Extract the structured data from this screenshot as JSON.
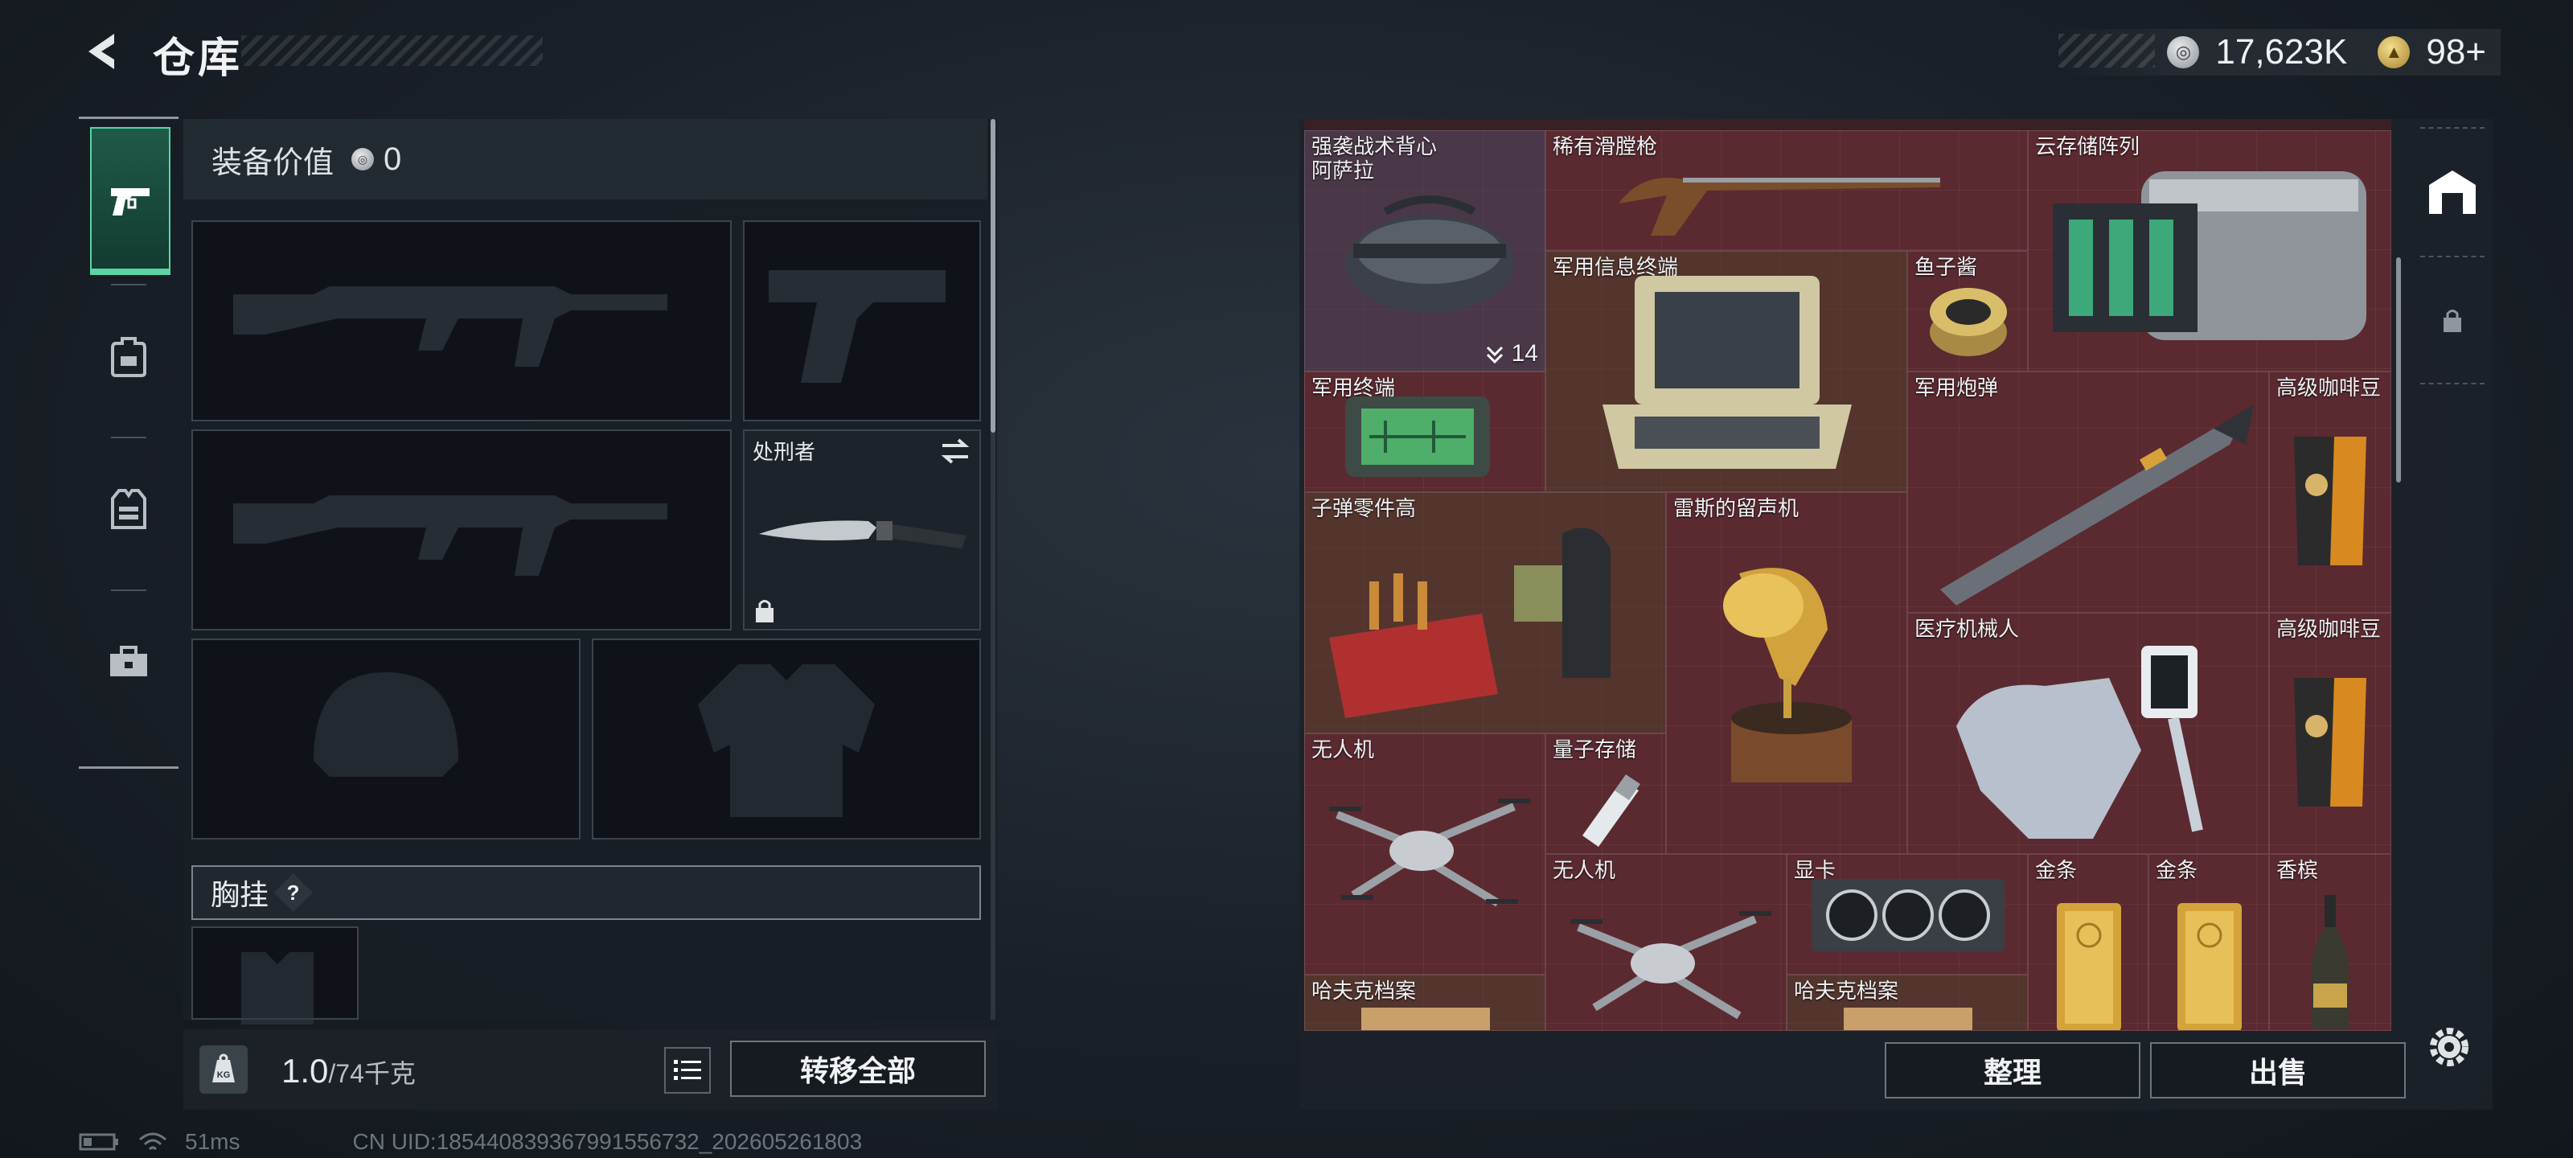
{
  "header": {
    "title": "仓库"
  },
  "currency": {
    "silver": "17,623K",
    "gold": "98+"
  },
  "left_tabs": [
    {
      "name": "weapons",
      "active": true
    },
    {
      "name": "backpack",
      "active": false
    },
    {
      "name": "vest",
      "active": false
    },
    {
      "name": "toolbox",
      "active": false
    }
  ],
  "equipment": {
    "value_label": "装备价值",
    "value": "0",
    "melee_name": "处刑者",
    "chest_label": "胸挂",
    "chest_help": "?"
  },
  "weight": {
    "current": "1.0",
    "max": "/74千克",
    "icon_text": "KG"
  },
  "buttons": {
    "transfer_all": "转移全部",
    "sort": "整理",
    "sell": "出售"
  },
  "status": {
    "ping": "51ms",
    "uid": "CN UID:1854408393679915567​32_202605261803"
  },
  "storage_items": [
    {
      "label": "强袭战术背心\n阿萨拉",
      "count": "14"
    },
    {
      "label": "稀有滑膛枪"
    },
    {
      "label": "云存储阵列"
    },
    {
      "label": "军用信息终端"
    },
    {
      "label": "鱼子酱"
    },
    {
      "label": "军用终端"
    },
    {
      "label": "军用炮弹"
    },
    {
      "label": "高级咖啡豆"
    },
    {
      "label": "子弹零件高"
    },
    {
      "label": "雷斯的留声机"
    },
    {
      "label": "医疗机械人"
    },
    {
      "label": "高级咖啡豆"
    },
    {
      "label": "无人机"
    },
    {
      "label": "量子存储"
    },
    {
      "label": "无人机"
    },
    {
      "label": "显卡"
    },
    {
      "label": "金条"
    },
    {
      "label": "金条"
    },
    {
      "label": "香槟"
    },
    {
      "label": "哈夫克档案"
    },
    {
      "label": "哈夫克档案"
    }
  ],
  "colors": {
    "accent": "#5bd4a4",
    "grid_bg": "#5a2a30"
  }
}
